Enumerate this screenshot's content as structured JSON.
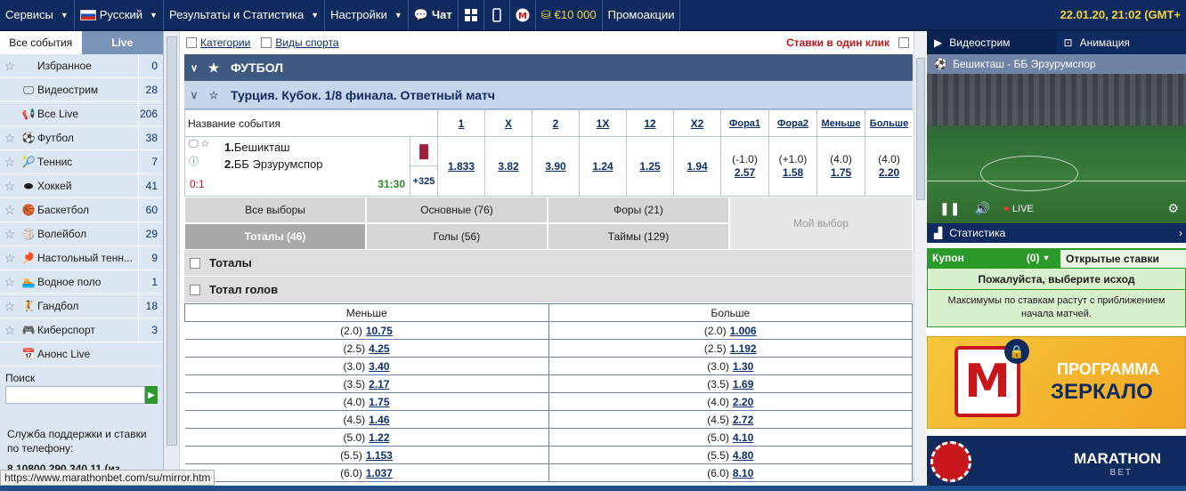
{
  "topnav": {
    "services": "Сервисы",
    "language": "Русский",
    "results": "Результаты и Статистика",
    "settings": "Настройки",
    "chat": "Чат",
    "bonus": "€10 000",
    "promo": "Промоакции",
    "datetime": "22.01.20, 21:02 (GMT+"
  },
  "sidebar": {
    "tabs": {
      "all": "Все события",
      "live": "Live"
    },
    "items": [
      {
        "label": "Избранное",
        "count": "0",
        "icon": "star-icon"
      },
      {
        "label": "Видеострим",
        "count": "28",
        "icon": "monitor-icon"
      },
      {
        "label": "Все Live",
        "count": "206",
        "icon": "megaphone-icon"
      },
      {
        "label": "Футбол",
        "count": "38",
        "icon": "football-icon"
      },
      {
        "label": "Теннис",
        "count": "7",
        "icon": "tennis-icon"
      },
      {
        "label": "Хоккей",
        "count": "41",
        "icon": "puck-icon"
      },
      {
        "label": "Баскетбол",
        "count": "60",
        "icon": "basketball-icon"
      },
      {
        "label": "Волейбол",
        "count": "29",
        "icon": "volleyball-icon"
      },
      {
        "label": "Настольный тенн...",
        "count": "9",
        "icon": "table-tennis-icon"
      },
      {
        "label": "Водное поло",
        "count": "1",
        "icon": "swimmer-icon"
      },
      {
        "label": "Гандбол",
        "count": "18",
        "icon": "handball-icon"
      },
      {
        "label": "Киберспорт",
        "count": "3",
        "icon": "gamepad-icon"
      },
      {
        "label": "Анонс Live",
        "count": "",
        "icon": "calendar-icon"
      }
    ],
    "search_label": "Поиск",
    "support_text": "Служба поддержки и ставки по телефону:",
    "phone": "8 10800 290 340 11 (из"
  },
  "main": {
    "filters": {
      "categories": "Категории",
      "sports": "Виды спорта",
      "one_click": "Ставки в один клик"
    },
    "sport_title": "ФУТБОЛ",
    "league_title": "Турция. Кубок. 1/8 финала. Ответный матч",
    "table_headers": [
      "Название события",
      "1",
      "X",
      "2",
      "1X",
      "12",
      "X2",
      "Фора1",
      "Фора2",
      "Меньше",
      "Больше"
    ],
    "event": {
      "team1": "Бешикташ",
      "team2": "ББ Эрзурумспор",
      "num1": "1.",
      "num2": "2.",
      "score": "0:1",
      "time": "31:30",
      "more": "+325",
      "odds": [
        "1.833",
        "3.82",
        "3.90",
        "1.24",
        "1.25",
        "1.94"
      ],
      "handicaps": [
        {
          "h": "(-1.0)",
          "v": "2.57"
        },
        {
          "h": "(+1.0)",
          "v": "1.58"
        },
        {
          "h": "(4.0)",
          "v": "1.75"
        },
        {
          "h": "(4.0)",
          "v": "2.20"
        }
      ]
    },
    "market_tabs": {
      "all": "Все выборы",
      "main": "Основные (76)",
      "handicaps": "Форы (21)",
      "my_choice": "Мой выбор",
      "totals": "Тоталы (46)",
      "goals": "Голы (56)",
      "halves": "Таймы (129)"
    },
    "section_totals": "Тоталы",
    "section_total_goals": "Тотал голов",
    "totals_table": {
      "under_header": "Меньше",
      "over_header": "Больше",
      "rows": [
        {
          "h": "(2.0)",
          "under": "10.75",
          "over": "1.006"
        },
        {
          "h": "(2.5)",
          "under": "4.25",
          "over": "1.192"
        },
        {
          "h": "(3.0)",
          "under": "3.40",
          "over": "1.30"
        },
        {
          "h": "(3.5)",
          "under": "2.17",
          "over": "1.69"
        },
        {
          "h": "(4.0)",
          "under": "1.75",
          "over": "2.20"
        },
        {
          "h": "(4.5)",
          "under": "1.46",
          "over": "2.72"
        },
        {
          "h": "(5.0)",
          "under": "1.22",
          "over": "4.10"
        },
        {
          "h": "(5.5)",
          "under": "1.153",
          "over": "4.80"
        },
        {
          "h": "(6.0)",
          "under": "1.037",
          "over": "8.10"
        }
      ]
    }
  },
  "right": {
    "tab_video": "Видеострим",
    "tab_animation": "Анимация",
    "video_title": "Бешикташ - ББ Эрзурумспор",
    "live_label": "LIVE",
    "stats_label": "Статистика",
    "coupon_label": "Купон",
    "coupon_count": "(0)",
    "open_bets": "Открытые ставки",
    "coupon_msg": "Пожалуйста, выберите исход",
    "coupon_note": "Максимумы по ставкам растут с приближением начала матчей.",
    "banner1_line1": "ПРОГРАММА",
    "banner1_line2": "ЗЕРКАЛО",
    "banner1_logo": "M",
    "banner2_title": "MARATHON",
    "banner2_sub": "BET"
  },
  "status_url": "https://www.marathonbet.com/su/mirror.htm",
  "colors": {
    "nav_bg": "#0e2a5f",
    "accent_green": "#2a9a2a",
    "score_red": "#c01818",
    "date_yellow": "#f5d432"
  }
}
